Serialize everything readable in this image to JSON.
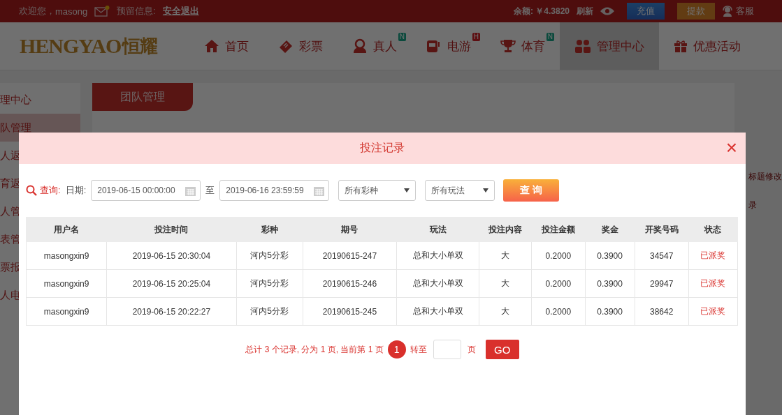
{
  "topbar": {
    "welcome": "欢迎您，",
    "user": "masong",
    "mail_unread": true,
    "reserved_label": "预留信息:",
    "logout": "安全退出",
    "balance": "余额: ￥4.3820",
    "refresh": "刷新",
    "deposit": "充值",
    "withdraw": "提款",
    "service": "客服"
  },
  "logo": {
    "latin": "HENGYAO",
    "cjk": "恒耀"
  },
  "nav": [
    {
      "label": "首页",
      "kind": "home",
      "selected": false
    },
    {
      "label": "彩票",
      "kind": "ticket",
      "selected": false
    },
    {
      "label": "真人",
      "kind": "person",
      "badge": "N",
      "selected": false
    },
    {
      "label": "电游",
      "kind": "slot",
      "badge": "H",
      "selected": false
    },
    {
      "label": "体育",
      "kind": "trophy",
      "badge": "N",
      "selected": false
    },
    {
      "label": "管理中心",
      "kind": "group",
      "selected": true
    },
    {
      "label": "优惠活动",
      "kind": "gift",
      "selected": false
    }
  ],
  "sidebar": {
    "items": [
      {
        "label": "理中心",
        "selected": false
      },
      {
        "label": "队管理",
        "selected": true
      },
      {
        "label": "人返",
        "selected": false
      },
      {
        "label": "育返",
        "selected": false
      },
      {
        "label": "人管",
        "selected": false
      },
      {
        "label": "表管",
        "selected": false
      },
      {
        "label": "票报",
        "selected": false
      },
      {
        "label": "人电",
        "selected": false
      }
    ]
  },
  "content": {
    "tab": "团队管理",
    "right_notes": [
      "标题修改",
      "录"
    ]
  },
  "modal": {
    "title": "投注记录",
    "close": "×",
    "filter": {
      "query_label": "查询:",
      "date_label": "日期:",
      "start": "2019-06-15 00:00:00",
      "to": "至",
      "end": "2019-06-16 23:59:59",
      "lottery": "所有彩种",
      "play": "所有玩法",
      "button": "查 询"
    },
    "table": {
      "columns": [
        "用户名",
        "投注时间",
        "彩种",
        "期号",
        "玩法",
        "投注内容",
        "投注金额",
        "奖金",
        "开奖号码",
        "状态"
      ],
      "rows": [
        [
          "masongxin9",
          "2019-06-15 20:30:04",
          "河内5分彩",
          "20190615-247",
          "总和大小单双",
          "大",
          "0.2000",
          "0.3900",
          "34547",
          "已派奖"
        ],
        [
          "masongxin9",
          "2019-06-15 20:25:04",
          "河内5分彩",
          "20190615-246",
          "总和大小单双",
          "大",
          "0.2000",
          "0.3900",
          "29947",
          "已派奖"
        ],
        [
          "masongxin9",
          "2019-06-15 20:22:27",
          "河内5分彩",
          "20190615-245",
          "总和大小单双",
          "大",
          "0.2000",
          "0.3900",
          "38642",
          "已派奖"
        ]
      ]
    },
    "pager": {
      "summary": "总计 3 个记录, 分为 1 页, 当前第 1 页",
      "pages": [
        {
          "label": "1",
          "selected": true
        }
      ],
      "goto": "转至",
      "unit": "页",
      "go": "GO"
    }
  }
}
